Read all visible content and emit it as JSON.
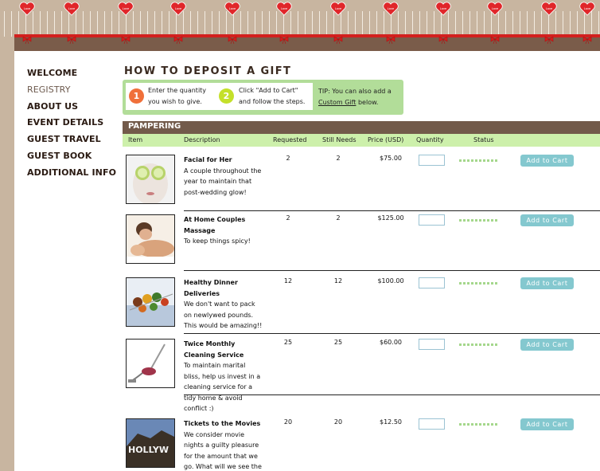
{
  "banner": {
    "heart_icons": [
      "heart-icon",
      "heart-icon",
      "heart-icon",
      "heart-icon",
      "heart-icon",
      "heart-icon",
      "heart-icon",
      "heart-icon",
      "heart-icon",
      "heart-icon",
      "heart-icon",
      "heart-icon"
    ],
    "heart_label": "Love",
    "colors": {
      "background": "#c8b5a0",
      "ribbon": "#d3201e",
      "band": "#7a5c4a"
    }
  },
  "nav": {
    "items": [
      {
        "label": "WELCOME"
      },
      {
        "label": "REGISTRY"
      },
      {
        "label": "ABOUT US"
      },
      {
        "label": "EVENT DETAILS"
      },
      {
        "label": "GUEST TRAVEL"
      },
      {
        "label": "GUEST BOOK"
      },
      {
        "label": "ADDITIONAL INFO"
      }
    ],
    "active": "REGISTRY"
  },
  "page": {
    "title": "HOW TO DEPOSIT A GIFT"
  },
  "instructions": {
    "step1": {
      "number": "1",
      "line1": "Enter the quantity",
      "line2": "you wish to give.",
      "color": "#f0703a"
    },
    "step2": {
      "number": "2",
      "line1": "Click \"Add to Cart\"",
      "line2": "and follow the steps.",
      "color": "#c4e02a"
    },
    "tip_line1": "TIP: You can also add a",
    "tip_link": "Custom Gift",
    "tip_after": " below."
  },
  "table": {
    "section": "PAMPERING",
    "columns": [
      "Item",
      "Description",
      "Requested",
      "Still Needs",
      "Price (USD)",
      "Quantity",
      "Status"
    ],
    "add_label": "Add to Cart",
    "rows": [
      {
        "title": "Facial for Her",
        "description": "A couple throughout the year to maintain that post-wedding glow!",
        "requested": "2",
        "still_needs": "2",
        "price": "$75.00",
        "quantity": "",
        "image": "facial-image"
      },
      {
        "title": "At Home Couples Massage",
        "description": "To keep things spicy!",
        "requested": "2",
        "still_needs": "2",
        "price": "$125.00",
        "quantity": "",
        "image": "massage-image"
      },
      {
        "title": "Healthy Dinner Deliveries",
        "description": "We don't want to pack on newlywed pounds. This would be amazing!!",
        "requested": "12",
        "still_needs": "12",
        "price": "$100.00",
        "quantity": "",
        "image": "dinner-image"
      },
      {
        "title": "Twice Monthly Cleaning Service",
        "description": "To maintain marital bliss, help us invest in a cleaning service for a tidy home & avoid conflict :)",
        "requested": "25",
        "still_needs": "25",
        "price": "$60.00",
        "quantity": "",
        "image": "vacuum-image"
      },
      {
        "title": "Tickets to the Movies",
        "description": "We consider movie nights a guilty pleasure for the amount that we go. What will we see the",
        "requested": "20",
        "still_needs": "20",
        "price": "$12.50",
        "quantity": "",
        "image": "hollywood-image",
        "image_text": "HOLLYW"
      }
    ]
  }
}
